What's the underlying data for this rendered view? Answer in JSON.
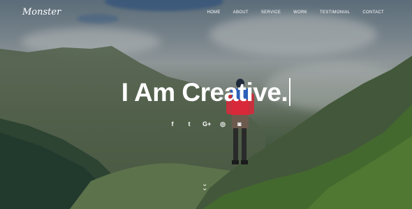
{
  "brand": {
    "logo": "Monster"
  },
  "nav": {
    "items": [
      "HOME",
      "ABOUT",
      "SERVICE",
      "WORK",
      "TESTIMONIAL",
      "CONTACT"
    ]
  },
  "hero": {
    "headline": "I Am Creative."
  },
  "social": [
    {
      "icon": "facebook-icon",
      "glyph": "f"
    },
    {
      "icon": "twitter-icon",
      "glyph": "t"
    },
    {
      "icon": "google-plus-icon",
      "glyph": "G+"
    },
    {
      "icon": "dribbble-icon",
      "glyph": "◎"
    },
    {
      "icon": "instagram-icon",
      "glyph": "◙"
    }
  ],
  "scroll": {
    "icon": "double-chevron-down-icon"
  }
}
